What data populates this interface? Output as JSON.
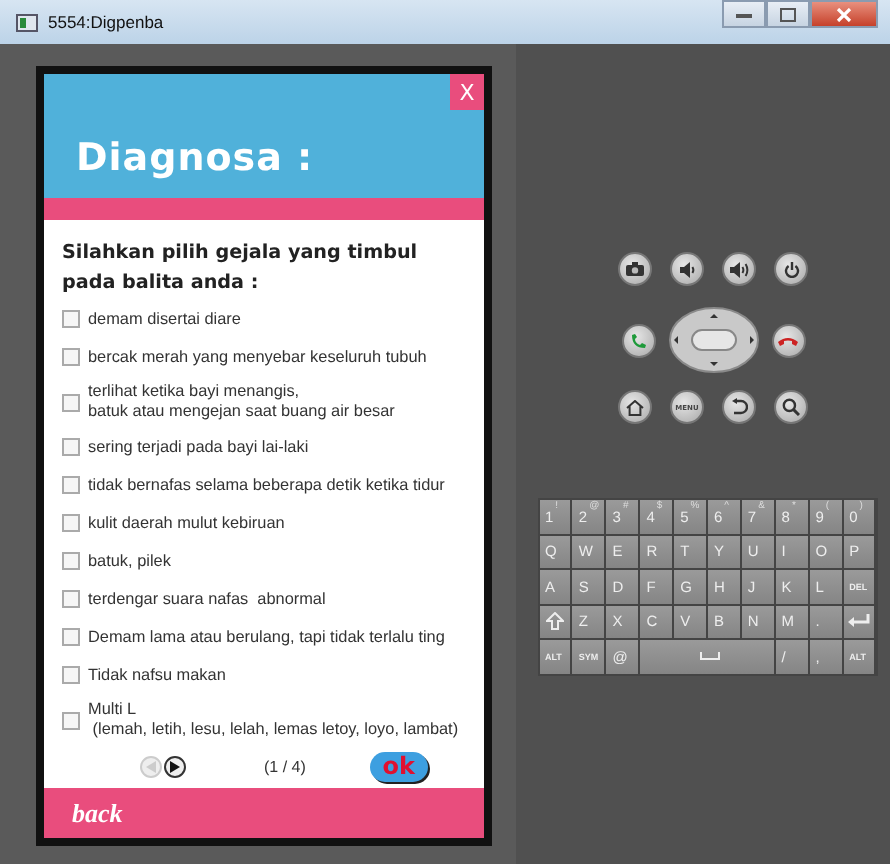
{
  "window": {
    "title": "5554:Digpenba"
  },
  "app": {
    "close_label": "X",
    "title": "Diagnosa :",
    "prompt": "Silahkan pilih gejala yang timbul pada balita anda :",
    "symptoms": [
      {
        "label": "demam disertai diare",
        "checked": false
      },
      {
        "label": "bercak merah yang menyebar keseluruh tubuh",
        "checked": false
      },
      {
        "label": "terlihat ketika bayi menangis,\nbatuk atau mengejan saat buang air besar",
        "checked": false
      },
      {
        "label": "sering terjadi pada bayi lai-laki",
        "checked": false
      },
      {
        "label": "tidak bernafas selama beberapa detik ketika tidur",
        "checked": false
      },
      {
        "label": "kulit daerah mulut kebiruan",
        "checked": false
      },
      {
        "label": "batuk, pilek",
        "checked": false
      },
      {
        "label": "terdengar suara nafas  abnormal",
        "checked": false
      },
      {
        "label": "Demam lama atau berulang, tapi tidak terlalu ting",
        "checked": false
      },
      {
        "label": "Tidak nafsu makan",
        "checked": false
      },
      {
        "label": "Multi L\n (lemah, letih, lesu, lelah, lemas letoy, loyo, lambat)",
        "checked": false
      }
    ],
    "pager": {
      "prev_disabled": true,
      "next_disabled": false,
      "page": "(1 / 4)",
      "ok": "ok"
    },
    "back": "back"
  },
  "controls": {
    "menu_label": "MENU"
  },
  "keyboard": {
    "rows": [
      [
        {
          "kind": "text",
          "label": "1",
          "alt": "!"
        },
        {
          "kind": "text",
          "label": "2",
          "alt": "@"
        },
        {
          "kind": "text",
          "label": "3",
          "alt": "#"
        },
        {
          "kind": "text",
          "label": "4",
          "alt": "$"
        },
        {
          "kind": "text",
          "label": "5",
          "alt": "%"
        },
        {
          "kind": "text",
          "label": "6",
          "alt": "^"
        },
        {
          "kind": "text",
          "label": "7",
          "alt": "&"
        },
        {
          "kind": "text",
          "label": "8",
          "alt": "*"
        },
        {
          "kind": "text",
          "label": "9",
          "alt": "("
        },
        {
          "kind": "text",
          "label": "0",
          "alt": ")"
        }
      ],
      [
        {
          "kind": "text",
          "label": "Q"
        },
        {
          "kind": "text",
          "label": "W"
        },
        {
          "kind": "text",
          "label": "E"
        },
        {
          "kind": "text",
          "label": "R"
        },
        {
          "kind": "text",
          "label": "T"
        },
        {
          "kind": "text",
          "label": "Y"
        },
        {
          "kind": "text",
          "label": "U"
        },
        {
          "kind": "text",
          "label": "I"
        },
        {
          "kind": "text",
          "label": "O"
        },
        {
          "kind": "text",
          "label": "P"
        }
      ],
      [
        {
          "kind": "text",
          "label": "A"
        },
        {
          "kind": "text",
          "label": "S"
        },
        {
          "kind": "text",
          "label": "D"
        },
        {
          "kind": "text",
          "label": "F"
        },
        {
          "kind": "text",
          "label": "G"
        },
        {
          "kind": "text",
          "label": "H"
        },
        {
          "kind": "text",
          "label": "J"
        },
        {
          "kind": "text",
          "label": "K"
        },
        {
          "kind": "text",
          "label": "L"
        },
        {
          "kind": "del",
          "label": "DEL"
        }
      ],
      [
        {
          "kind": "shift"
        },
        {
          "kind": "text",
          "label": "Z"
        },
        {
          "kind": "text",
          "label": "X"
        },
        {
          "kind": "text",
          "label": "C"
        },
        {
          "kind": "text",
          "label": "V"
        },
        {
          "kind": "text",
          "label": "B"
        },
        {
          "kind": "text",
          "label": "N"
        },
        {
          "kind": "text",
          "label": "M"
        },
        {
          "kind": "text",
          "label": "."
        },
        {
          "kind": "enter"
        }
      ],
      [
        {
          "kind": "small",
          "label": "ALT"
        },
        {
          "kind": "small",
          "label": "SYM"
        },
        {
          "kind": "text",
          "label": "@"
        },
        {
          "kind": "space"
        },
        "",
        "",
        "",
        {
          "kind": "text",
          "label": "/"
        },
        {
          "kind": "text",
          "label": ","
        },
        {
          "kind": "small",
          "label": "ALT"
        }
      ]
    ]
  }
}
